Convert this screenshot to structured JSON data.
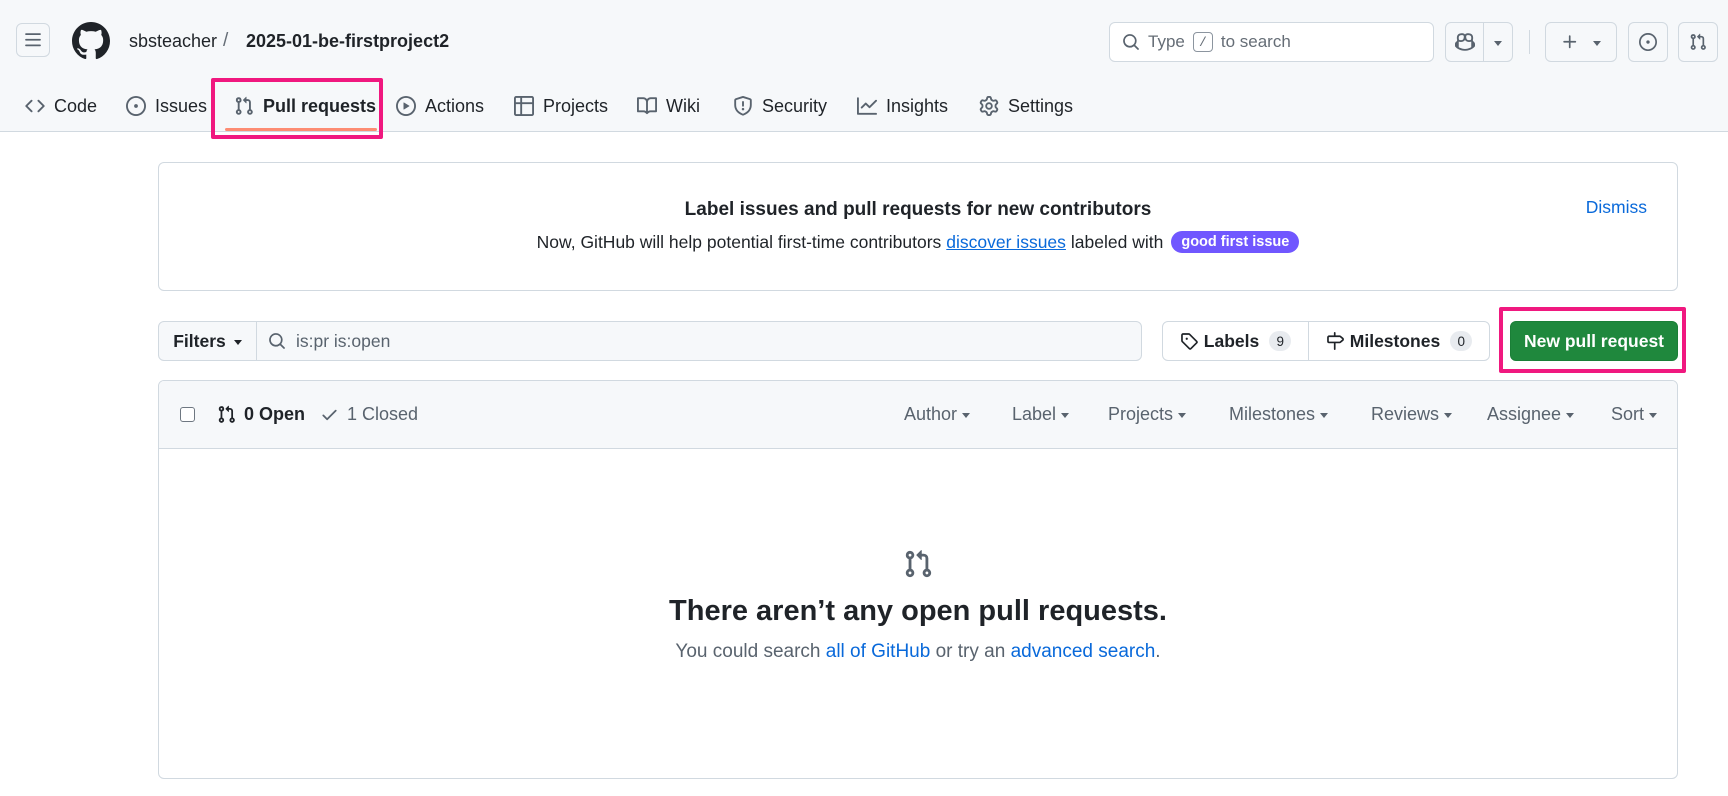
{
  "header": {
    "owner": "sbsteacher",
    "separator": "/",
    "repo": "2025-01-be-firstproject2",
    "search_prefix": "Type",
    "search_key": "/",
    "search_suffix": "to search"
  },
  "tabs": [
    {
      "label": "Code",
      "icon": "code-icon"
    },
    {
      "label": "Issues",
      "icon": "issue-opened-icon"
    },
    {
      "label": "Pull requests",
      "icon": "git-pull-request-icon",
      "active": true
    },
    {
      "label": "Actions",
      "icon": "play-icon"
    },
    {
      "label": "Projects",
      "icon": "table-icon"
    },
    {
      "label": "Wiki",
      "icon": "book-icon"
    },
    {
      "label": "Security",
      "icon": "shield-icon"
    },
    {
      "label": "Insights",
      "icon": "graph-icon"
    },
    {
      "label": "Settings",
      "icon": "gear-icon"
    }
  ],
  "banner": {
    "title": "Label issues and pull requests for new contributors",
    "desc_before": "Now, GitHub will help potential first-time contributors",
    "desc_link": "discover issues",
    "desc_after": "labeled with",
    "badge": "good first issue",
    "dismiss": "Dismiss"
  },
  "filter_bar": {
    "filters_label": "Filters",
    "query": "is:pr is:open",
    "labels_label": "Labels",
    "labels_count": "9",
    "milestones_label": "Milestones",
    "milestones_count": "0",
    "new_pr_label": "New pull request"
  },
  "list": {
    "open_label": "0 Open",
    "closed_label": "1 Closed",
    "filters": [
      "Author",
      "Label",
      "Projects",
      "Milestones",
      "Reviews",
      "Assignee",
      "Sort"
    ]
  },
  "blankslate": {
    "title": "There aren’t any open pull requests.",
    "desc_before": "You could search",
    "link1": "all of GitHub",
    "desc_middle": "or try an",
    "link2": "advanced search",
    "desc_after": "."
  },
  "colors": {
    "primary_button": "#1f883d",
    "link": "#0969da",
    "badge": "#7057ff",
    "highlight": "#f0187f",
    "active_underline": "#fd8c73"
  }
}
